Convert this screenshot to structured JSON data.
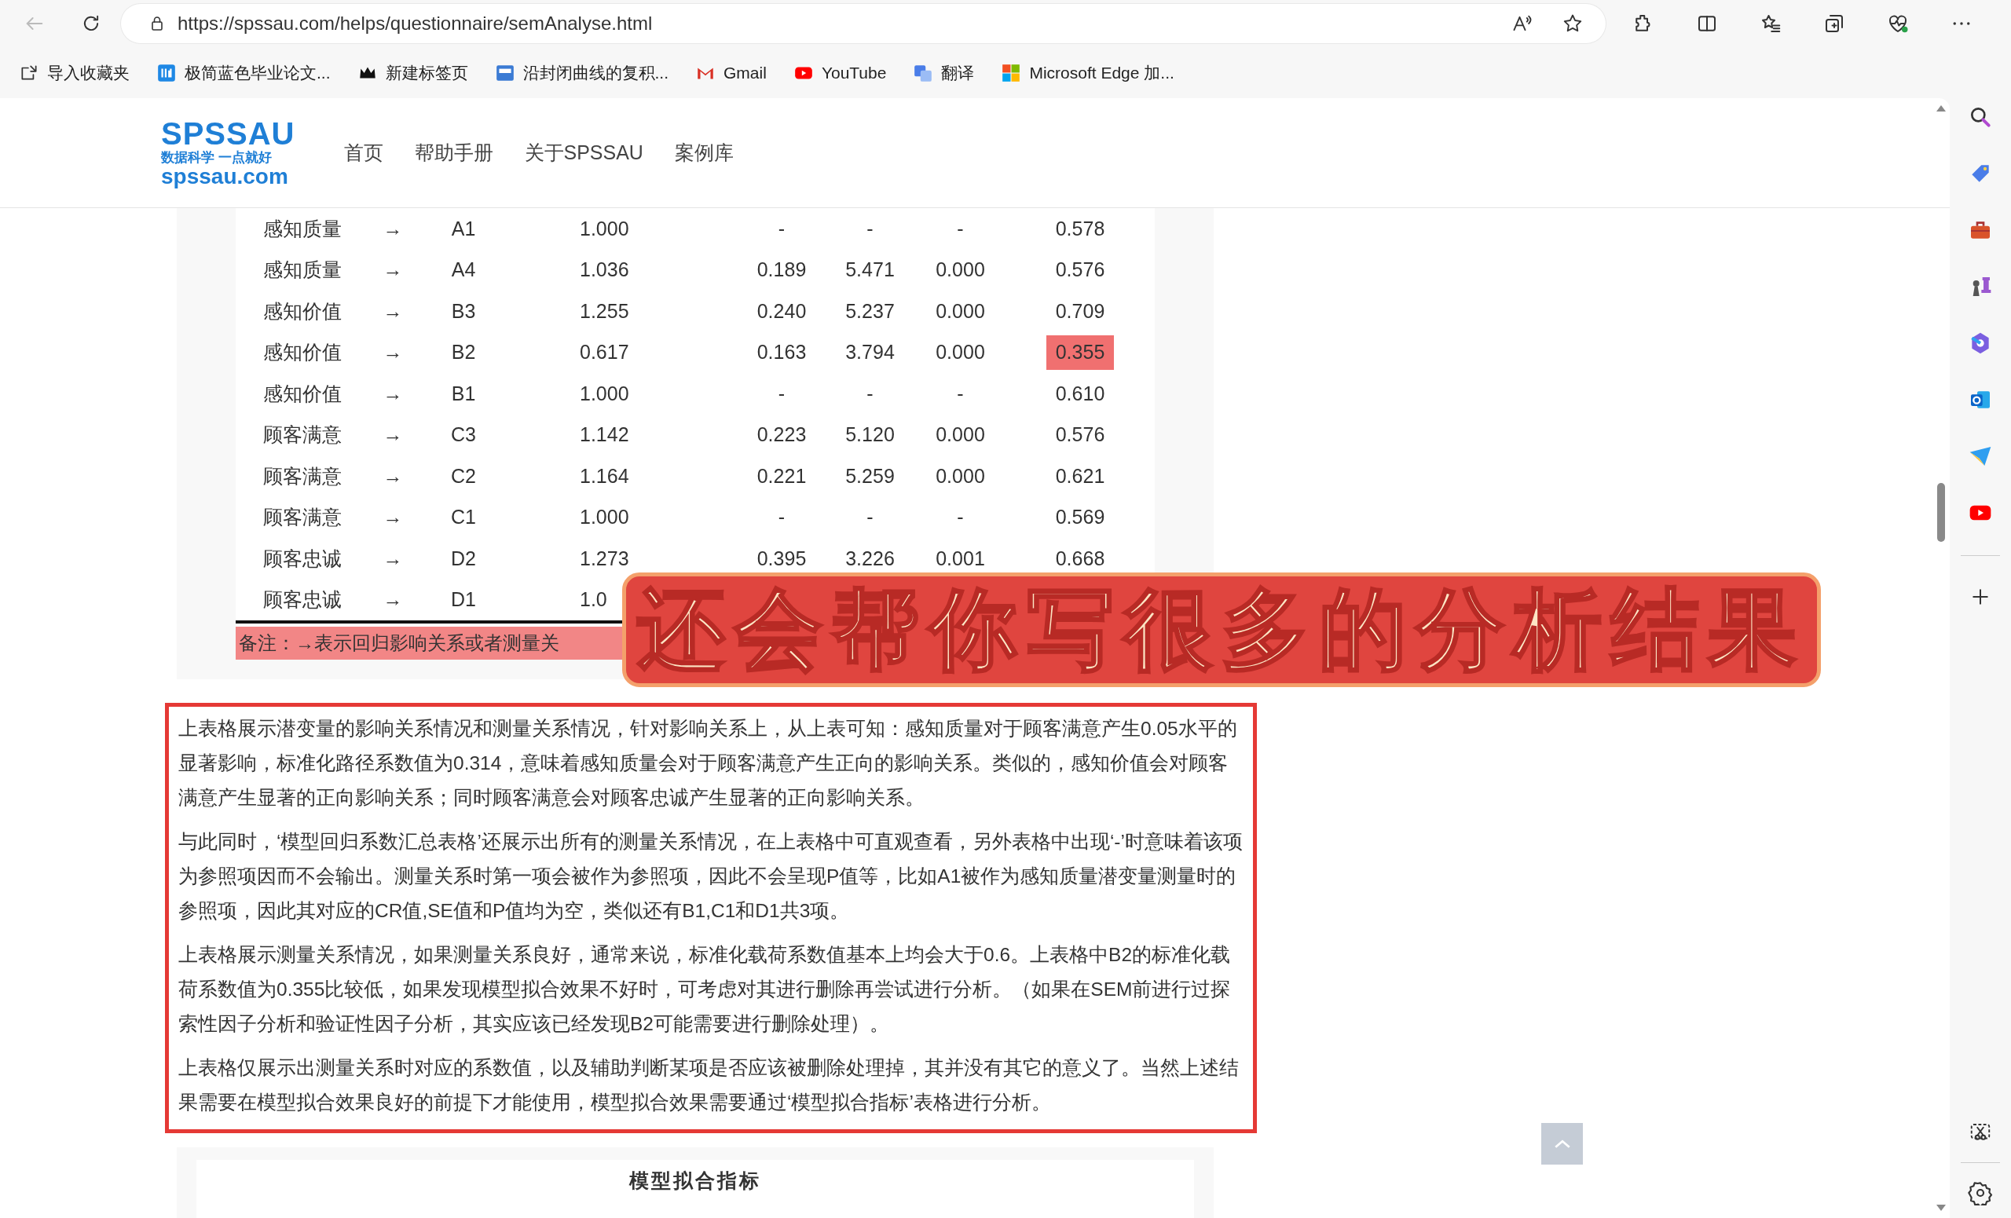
{
  "browser": {
    "url": "https://spssau.com/helps/questionnaire/semAnalyse.html",
    "bookmarks": [
      {
        "label": "导入收藏夹",
        "kind": "import"
      },
      {
        "label": "极简蓝色毕业论文...",
        "kind": "site"
      },
      {
        "label": "新建标签页",
        "kind": "crown"
      },
      {
        "label": "沿封闭曲线的复积...",
        "kind": "doc"
      },
      {
        "label": "Gmail",
        "kind": "gmail"
      },
      {
        "label": "YouTube",
        "kind": "youtube"
      },
      {
        "label": "翻译",
        "kind": "translate"
      },
      {
        "label": "Microsoft Edge 加...",
        "kind": "microsoft"
      }
    ]
  },
  "site": {
    "logo": {
      "name": "SPSSAU",
      "slogan": "数据科学 一点就好",
      "domain": "spssau.com"
    },
    "nav": [
      {
        "label": "首页"
      },
      {
        "label": "帮助手册"
      },
      {
        "label": "关于SPSSAU"
      },
      {
        "label": "案例库"
      }
    ]
  },
  "table": {
    "rows": [
      {
        "cells": [
          "感知质量",
          "→",
          "A1",
          "1.000",
          "-",
          "-",
          "-",
          "0.578"
        ],
        "flagged": false
      },
      {
        "cells": [
          "感知质量",
          "→",
          "A4",
          "1.036",
          "0.189",
          "5.471",
          "0.000",
          "0.576"
        ],
        "flagged": false
      },
      {
        "cells": [
          "感知价值",
          "→",
          "B3",
          "1.255",
          "0.240",
          "5.237",
          "0.000",
          "0.709"
        ],
        "flagged": false
      },
      {
        "cells": [
          "感知价值",
          "→",
          "B2",
          "0.617",
          "0.163",
          "3.794",
          "0.000",
          "0.355"
        ],
        "flagged": true
      },
      {
        "cells": [
          "感知价值",
          "→",
          "B1",
          "1.000",
          "-",
          "-",
          "-",
          "0.610"
        ],
        "flagged": false
      },
      {
        "cells": [
          "顾客满意",
          "→",
          "C3",
          "1.142",
          "0.223",
          "5.120",
          "0.000",
          "0.576"
        ],
        "flagged": false
      },
      {
        "cells": [
          "顾客满意",
          "→",
          "C2",
          "1.164",
          "0.221",
          "5.259",
          "0.000",
          "0.621"
        ],
        "flagged": false
      },
      {
        "cells": [
          "顾客满意",
          "→",
          "C1",
          "1.000",
          "-",
          "-",
          "-",
          "0.569"
        ],
        "flagged": false
      },
      {
        "cells": [
          "顾客忠诚",
          "→",
          "D2",
          "1.273",
          "0.395",
          "3.226",
          "0.001",
          "0.668"
        ],
        "flagged": false
      },
      {
        "cells": [
          "顾客忠诚",
          "→",
          "D1",
          "1.0"
        ],
        "flagged": false
      }
    ],
    "note": "备注：→表示回归影响关系或者测量关"
  },
  "paragraphs": [
    "上表格展示潜变量的影响关系情况和测量关系情况，针对影响关系上，从上表可知：感知质量对于顾客满意产生0.05水平的显著影响，标准化路径系数值为0.314，意味着感知质量会对于顾客满意产生正向的影响关系。类似的，感知价值会对顾客满意产生显著的正向影响关系；同时顾客满意会对顾客忠诚产生显著的正向影响关系。",
    "与此同时，‘模型回归系数汇总表格’还展示出所有的测量关系情况，在上表格中可直观查看，另外表格中出现‘-’时意味着该项为参照项因而不会输出。测量关系时第一项会被作为参照项，因此不会呈现P值等，比如A1被作为感知质量潜变量测量时的参照项，因此其对应的CR值,SE值和P值均为空，类似还有B1,C1和D1共3项。",
    "上表格展示测量关系情况，如果测量关系良好，通常来说，标准化载荷系数值基本上均会大于0.6。上表格中B2的标准化载荷系数值为0.355比较低，如果发现模型拟合效果不好时，可考虑对其进行删除再尝试进行分析。（如果在SEM前进行过探索性因子分析和验证性因子分析，其实应该已经发现B2可能需要进行删除处理）。",
    "上表格仅展示出测量关系时对应的系数值，以及辅助判断某项是否应该被删除处理掉，其并没有其它的意义了。当然上述结果需要在模型拟合效果良好的前提下才能使用，模型拟合效果需要通过‘模型拟合指标’表格进行分析。"
  ],
  "next_section": {
    "title": "模型拟合指标"
  },
  "overlay_caption": "还会帮你写很多的分析结果"
}
